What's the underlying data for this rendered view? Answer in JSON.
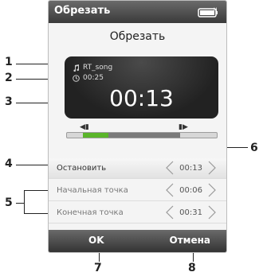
{
  "window_title": "Обрезать",
  "header": {
    "title": "Обрезать"
  },
  "player": {
    "song_name": "RT_song",
    "song_duration": "00:25",
    "current_time": "00:13"
  },
  "trim": {
    "played_fraction": 0.17,
    "start_fraction": 0.11,
    "end_fraction": 0.86
  },
  "rows": {
    "stop": {
      "label": "Остановить",
      "value": "00:13"
    },
    "start_point": {
      "label": "Начальная точка",
      "value": "00:06"
    },
    "end_point": {
      "label": "Конечная точка",
      "value": "00:31"
    }
  },
  "softkeys": {
    "left": "OK",
    "right": "Отмена"
  },
  "callouts": [
    "1",
    "2",
    "3",
    "4",
    "5",
    "6",
    "7",
    "8"
  ],
  "icons": [
    "music-note-icon",
    "clock-icon",
    "battery-icon",
    "start-marker-icon",
    "end-marker-icon",
    "left-arrow-icon",
    "right-arrow-icon"
  ]
}
